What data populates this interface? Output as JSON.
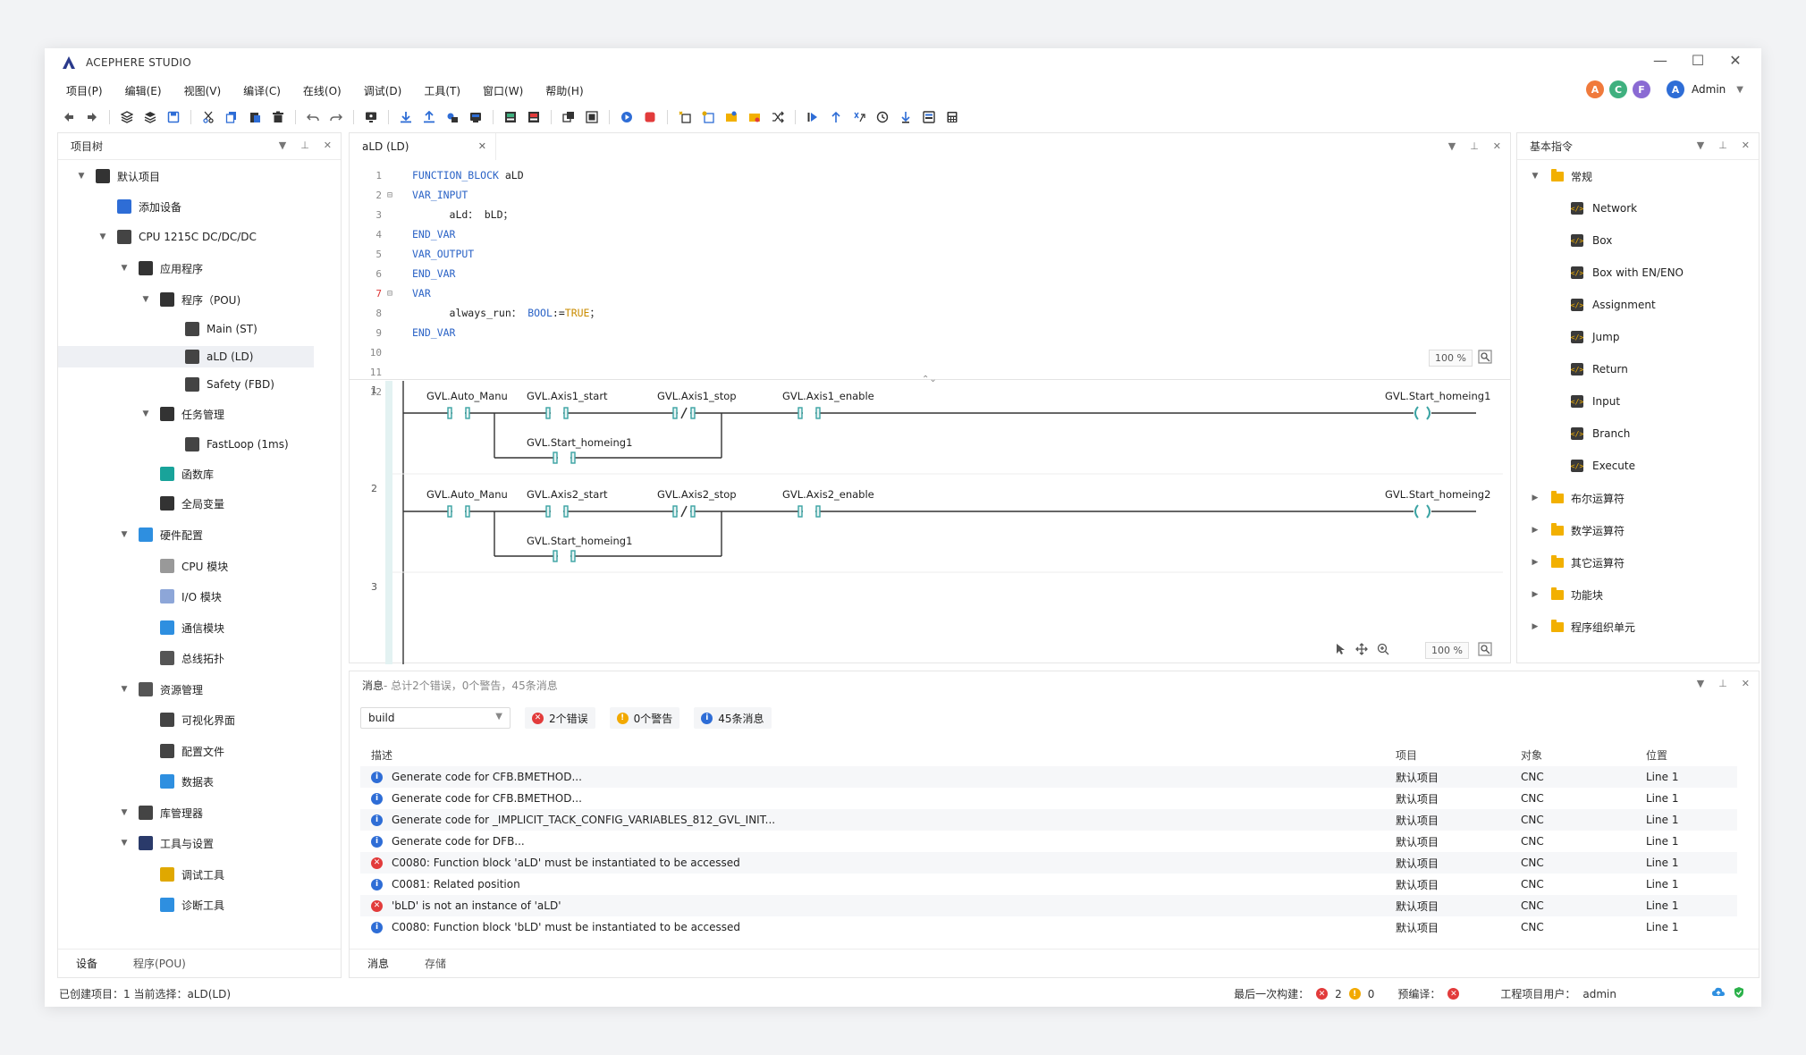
{
  "app": {
    "title": "ACEPHERE STUDIO",
    "accent": "#2e6dd6"
  },
  "window_controls": {
    "minimize": "—",
    "maximize": "☐",
    "close": "✕"
  },
  "menu": [
    "项目(P)",
    "编辑(E)",
    "视图(V)",
    "编译(C)",
    "在线(O)",
    "调试(D)",
    "工具(T)",
    "窗口(W)",
    "帮助(H)"
  ],
  "users": {
    "avatars": [
      {
        "letter": "A",
        "color": "#f07a3c"
      },
      {
        "letter": "C",
        "color": "#3fb07f"
      },
      {
        "letter": "F",
        "color": "#8a6ad3"
      }
    ],
    "current": {
      "letter": "A",
      "color": "#2e6dd6",
      "name": "Admin"
    }
  },
  "project_tree": {
    "title": "项目树",
    "nodes": [
      {
        "label": "默认项目",
        "level": 0,
        "arrow": "▼",
        "icon": "layers-icon",
        "color": "#333"
      },
      {
        "label": "添加设备",
        "level": 1,
        "arrow": "",
        "icon": "add-device-icon",
        "color": "#2e6dd6"
      },
      {
        "label": "CPU 1215C DC/DC/DC",
        "level": 1,
        "arrow": "▼",
        "icon": "cpu-icon",
        "color": "#444"
      },
      {
        "label": "应用程序",
        "level": 2,
        "arrow": "▼",
        "icon": "cube-icon",
        "color": "#333"
      },
      {
        "label": "程序（POU)",
        "level": 3,
        "arrow": "▼",
        "icon": "program-icon",
        "color": "#333"
      },
      {
        "label": "Main (ST)",
        "level": 4,
        "arrow": "",
        "icon": "st-file-icon",
        "color": "#444"
      },
      {
        "label": "aLD (LD)",
        "level": 4,
        "arrow": "",
        "icon": "ld-file-icon",
        "color": "#444",
        "selected": true
      },
      {
        "label": "Safety (FBD)",
        "level": 4,
        "arrow": "",
        "icon": "fbd-file-icon",
        "color": "#444"
      },
      {
        "label": "任务管理",
        "level": 3,
        "arrow": "▼",
        "icon": "task-icon",
        "color": "#333"
      },
      {
        "label": "FastLoop (1ms)",
        "level": 4,
        "arrow": "",
        "icon": "loop-icon",
        "color": "#444"
      },
      {
        "label": "函数库",
        "level": 3,
        "arrow": "",
        "icon": "function-icon",
        "color": "#19a39a"
      },
      {
        "label": "全局变量",
        "level": 3,
        "arrow": "",
        "icon": "global-var-icon",
        "color": "#333"
      },
      {
        "label": "硬件配置",
        "level": 2,
        "arrow": "▼",
        "icon": "hardware-icon",
        "color": "#2e8fe0"
      },
      {
        "label": "CPU 模块",
        "level": 3,
        "arrow": "",
        "icon": "cpu-module-icon",
        "color": "#999"
      },
      {
        "label": "I/O 模块",
        "level": 3,
        "arrow": "",
        "icon": "io-module-icon",
        "color": "#8da6d8"
      },
      {
        "label": "通信模块",
        "level": 3,
        "arrow": "",
        "icon": "comm-module-icon",
        "color": "#2e8fe0"
      },
      {
        "label": "总线拓扑",
        "level": 3,
        "arrow": "",
        "icon": "topology-icon",
        "color": "#555"
      },
      {
        "label": "资源管理",
        "level": 2,
        "arrow": "▼",
        "icon": "resource-icon",
        "color": "#555"
      },
      {
        "label": "可视化界面",
        "level": 3,
        "arrow": "",
        "icon": "hmi-icon",
        "color": "#444"
      },
      {
        "label": "配置文件",
        "level": 3,
        "arrow": "",
        "icon": "config-file-icon",
        "color": "#444"
      },
      {
        "label": "数据表",
        "level": 3,
        "arrow": "",
        "icon": "data-table-icon",
        "color": "#2e8fe0"
      },
      {
        "label": "库管理器",
        "level": 2,
        "arrow": "▼",
        "icon": "library-icon",
        "color": "#444"
      },
      {
        "label": "工具与设置",
        "level": 2,
        "arrow": "▼",
        "icon": "tools-icon",
        "color": "#2a3a6a"
      },
      {
        "label": "调试工具",
        "level": 3,
        "arrow": "",
        "icon": "debug-tool-icon",
        "color": "#e0a800"
      },
      {
        "label": "诊断工具",
        "level": 3,
        "arrow": "",
        "icon": "diagnose-tool-icon",
        "color": "#2e8fe0"
      }
    ],
    "tabs": [
      "设备",
      "程序(POU)"
    ]
  },
  "editor": {
    "tab": "aLD (LD)",
    "code": [
      {
        "n": "1",
        "fold": "",
        "parts": [
          {
            "t": "FUNCTION_BLOCK ",
            "c": "kw"
          },
          {
            "t": "aLD",
            "c": "vn"
          }
        ]
      },
      {
        "n": "2",
        "fold": "⊟",
        "parts": [
          {
            "t": "VAR_INPUT",
            "c": "kw"
          }
        ]
      },
      {
        "n": "3",
        "fold": "",
        "parts": [
          {
            "t": "      aLd： bLD；",
            "c": "vn"
          }
        ]
      },
      {
        "n": "4",
        "fold": "",
        "parts": [
          {
            "t": "END_VAR",
            "c": "kw"
          }
        ]
      },
      {
        "n": "5",
        "fold": "",
        "parts": [
          {
            "t": "VAR_OUTPUT",
            "c": "kw"
          }
        ]
      },
      {
        "n": "6",
        "fold": "",
        "parts": [
          {
            "t": "END_VAR",
            "c": "kw"
          }
        ]
      },
      {
        "n": "7",
        "fold": "⊟",
        "red": true,
        "parts": [
          {
            "t": "VAR",
            "c": "kw"
          }
        ]
      },
      {
        "n": "8",
        "fold": "",
        "parts": [
          {
            "t": "      always_run： ",
            "c": "vn"
          },
          {
            "t": "BOOL",
            "c": "kw"
          },
          {
            "t": ":=",
            "c": "vn"
          },
          {
            "t": "TRUE",
            "c": "tv"
          },
          {
            "t": "；",
            "c": "vn"
          }
        ]
      },
      {
        "n": "9",
        "fold": "",
        "parts": [
          {
            "t": "END_VAR",
            "c": "kw"
          }
        ]
      },
      {
        "n": "10",
        "fold": "",
        "parts": []
      },
      {
        "n": "11",
        "fold": "",
        "parts": []
      },
      {
        "n": "12",
        "fold": "",
        "parts": []
      }
    ],
    "zoom_code": "100 %",
    "zoom_ladder": "100 %"
  },
  "ladder": {
    "rungs": [
      {
        "number": "1",
        "contacts": [
          {
            "name": "GVL.Auto_Manu",
            "kind": "NO"
          },
          {
            "name": "GVL.Axis1_start",
            "kind": "NO"
          },
          {
            "name": "GVL.Axis1_stop",
            "kind": "NC"
          },
          {
            "name": "GVL.Axis1_enable",
            "kind": "NO"
          }
        ],
        "branch": "GVL.Start_homeing1",
        "coil": "GVL.Start_homeing1"
      },
      {
        "number": "2",
        "contacts": [
          {
            "name": "GVL.Auto_Manu",
            "kind": "NO"
          },
          {
            "name": "GVL.Axis2_start",
            "kind": "NO"
          },
          {
            "name": "GVL.Axis2_stop",
            "kind": "NC"
          },
          {
            "name": "GVL.Axis2_enable",
            "kind": "NO"
          }
        ],
        "branch": "GVL.Start_homeing1",
        "coil": "GVL.Start_homeing2"
      },
      {
        "number": "3"
      }
    ]
  },
  "instructions": {
    "title": "基本指令",
    "group_open": "常规",
    "items": [
      "Network",
      "Box",
      "Box with EN/ENO",
      "Assignment",
      "Jump",
      "Return",
      "Input",
      "Branch",
      "Execute"
    ],
    "groups_closed": [
      "布尔运算符",
      "数学运算符",
      "其它运算符",
      "功能块",
      "程序组织单元"
    ]
  },
  "messages": {
    "title": "消息",
    "summary": " - 总计2个错误，0个警告，45条消息",
    "filter": "build",
    "errors_btn": "2个错误",
    "warnings_btn": "0个警告",
    "infos_btn": "45条消息",
    "columns": [
      "描述",
      "项目",
      "对象",
      "位置"
    ],
    "rows": [
      {
        "type": "info",
        "desc": "Generate code for CFB.BMETHOD...",
        "project": "默认项目",
        "object": "CNC",
        "pos": "Line 1"
      },
      {
        "type": "info",
        "desc": "Generate code for CFB.BMETHOD...",
        "project": "默认项目",
        "object": "CNC",
        "pos": "Line 1"
      },
      {
        "type": "info",
        "desc": "Generate code for _IMPLICIT_TACK_CONFIG_VARIABLES_812_GVL_INIT...",
        "project": "默认项目",
        "object": "CNC",
        "pos": "Line 1"
      },
      {
        "type": "info",
        "desc": "Generate code for DFB...",
        "project": "默认项目",
        "object": "CNC",
        "pos": "Line 1"
      },
      {
        "type": "err",
        "desc": "C0080: Function block 'aLD' must be instantiated to be accessed",
        "project": "默认项目",
        "object": "CNC",
        "pos": "Line 1"
      },
      {
        "type": "info",
        "desc": "C0081: Related position",
        "project": "默认项目",
        "object": "CNC",
        "pos": "Line 1"
      },
      {
        "type": "err",
        "desc": "'bLD' is not an instance of 'aLD'",
        "project": "默认项目",
        "object": "CNC",
        "pos": "Line 1"
      },
      {
        "type": "info",
        "desc": "C0080: Function block 'bLD' must be instantiated to be accessed",
        "project": "默认项目",
        "object": "CNC",
        "pos": "Line 1"
      }
    ],
    "tabs": [
      "消息",
      "存储"
    ]
  },
  "status": {
    "left": "已创建项目：1   当前选择：aLD(LD)",
    "last_build_label": "最后一次构建：",
    "err_count": "2",
    "warn_count": "0",
    "precompile_label": "预编译：",
    "user_label": "工程项目用户：",
    "user": "admin"
  }
}
